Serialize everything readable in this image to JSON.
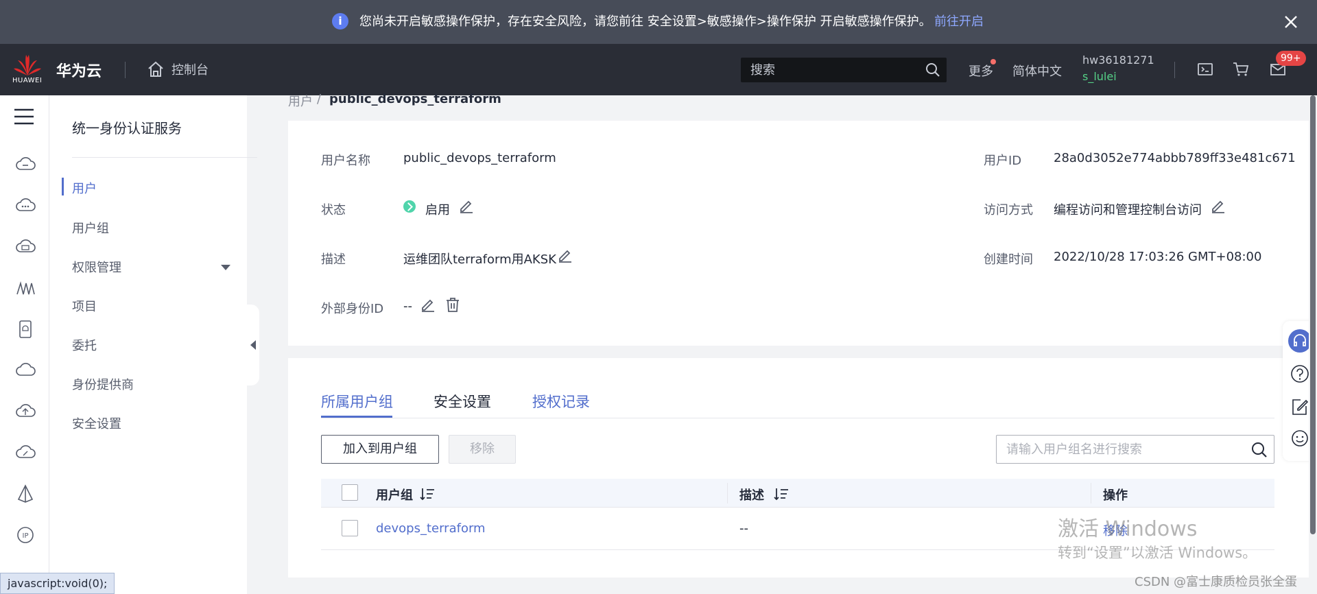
{
  "banner": {
    "text": "您尚未开启敏感操作保护，存在安全风险，请您前往 安全设置>敏感操作>操作保护 开启敏感操作保护。",
    "link": "前往开启"
  },
  "topnav": {
    "logo_text": "HUAWEI",
    "brand": "华为云",
    "console": "控制台",
    "search_placeholder": "搜索",
    "more": "更多",
    "language": "简体中文",
    "account": "hw36181271",
    "user": "s_lulei",
    "badge": "99+"
  },
  "sidemenu": {
    "title": "统一身份认证服务",
    "items": [
      {
        "label": "用户"
      },
      {
        "label": "用户组"
      },
      {
        "label": "权限管理"
      },
      {
        "label": "项目"
      },
      {
        "label": "委托"
      },
      {
        "label": "身份提供商"
      },
      {
        "label": "安全设置"
      }
    ]
  },
  "breadcrumb": {
    "parent": "用户",
    "separator": "/",
    "current": "public_devops_terraform"
  },
  "details": {
    "username_label": "用户名称",
    "username": "public_devops_terraform",
    "status_label": "状态",
    "status": "启用",
    "desc_label": "描述",
    "desc": "运维团队terraform用AKSK",
    "external_id_label": "外部身份ID",
    "external_id": "--",
    "userid_label": "用户ID",
    "userid": "28a0d3052e774abbb789ff33e481c671",
    "access_label": "访问方式",
    "access": "编程访问和管理控制台访问",
    "created_label": "创建时间",
    "created": "2022/10/28 17:03:26 GMT+08:00"
  },
  "tabs": [
    {
      "label": "所属用户组"
    },
    {
      "label": "安全设置"
    },
    {
      "label": "授权记录"
    }
  ],
  "toolbar": {
    "add": "加入到用户组",
    "remove": "移除",
    "search_placeholder": "请输入用户组名进行搜索"
  },
  "table": {
    "columns": [
      "用户组",
      "描述",
      "操作"
    ],
    "rows": [
      {
        "group": "devops_terraform",
        "desc": "--",
        "action": "移除"
      }
    ]
  },
  "overlay": {
    "watermark_line1": "激活 Windows",
    "watermark_line2": "转到“设置”以激活 Windows。",
    "csdn": "CSDN @富士康质检员张全蛋",
    "statusbar": "javascript:void(0);"
  },
  "colors": {
    "accent": "#526ecc",
    "banner_bg": "#474c58",
    "nav_bg": "#2a2d36",
    "status_green": "#50d4ab",
    "badge_red": "#e54545"
  }
}
